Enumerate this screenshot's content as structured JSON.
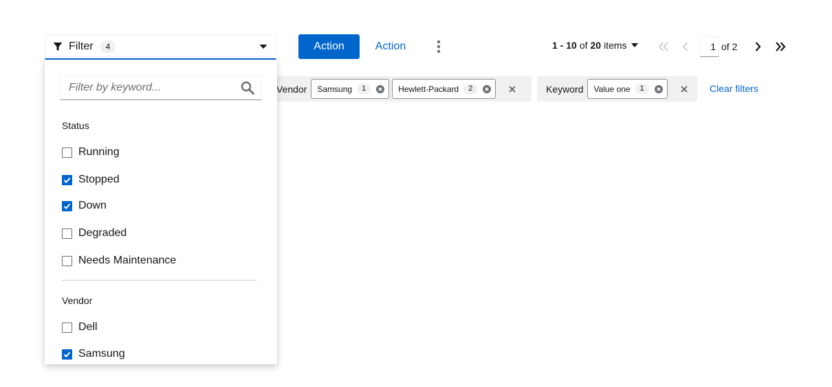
{
  "filter_toggle": {
    "label": "Filter",
    "count": "4",
    "icon": "filter-icon"
  },
  "toolbar": {
    "primary_label": "Action",
    "link_label": "Action",
    "kebab_icon": "kebab-icon"
  },
  "pagination": {
    "range": "1 - 10",
    "of_word": "of",
    "total": "20",
    "items_word": "items",
    "page_value": "1",
    "of_pages": "of 2"
  },
  "chip_groups": [
    {
      "category": "Vendor",
      "chips": [
        {
          "label": "Samsung",
          "count": "1"
        },
        {
          "label": "Hewlett-Packard",
          "count": "2"
        }
      ]
    },
    {
      "category": "Keyword",
      "chips": [
        {
          "label": "Value one",
          "count": "1"
        }
      ]
    }
  ],
  "clear_filters": "Clear filters",
  "dropdown": {
    "search_placeholder": "Filter by keyword...",
    "groups": [
      {
        "title": "Status",
        "options": [
          {
            "label": "Running",
            "checked": false
          },
          {
            "label": "Stopped",
            "checked": true
          },
          {
            "label": "Down",
            "checked": true
          },
          {
            "label": "Degraded",
            "checked": false
          },
          {
            "label": "Needs Maintenance",
            "checked": false
          }
        ]
      },
      {
        "title": "Vendor",
        "options": [
          {
            "label": "Dell",
            "checked": false
          },
          {
            "label": "Samsung",
            "checked": true
          }
        ]
      }
    ]
  },
  "colors": {
    "primary": "#0066cc",
    "chip_bg": "#f0f0f0",
    "text": "#151515"
  }
}
